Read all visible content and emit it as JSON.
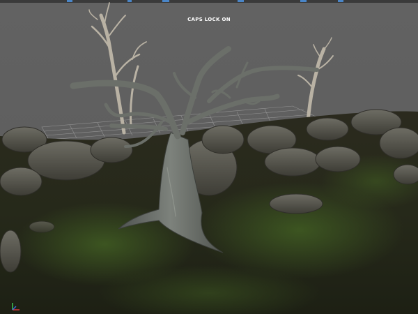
{
  "viewport": {
    "status_message": "CAPS LOCK ON",
    "background_color": "#5f5f5f",
    "grid_color": "#9a9a9a"
  },
  "scene": {
    "objects": [
      "dead-tree-left-icon",
      "dead-tree-right-icon",
      "twisted-tree-icon",
      "rocks-icon",
      "mossy-ground-icon",
      "ground-grid-icon"
    ]
  },
  "gizmo": {
    "icon": "axis-gizmo-icon",
    "x_color": "#e23b3b",
    "y_color": "#3bd15a",
    "z_color": "#3b6be2"
  }
}
